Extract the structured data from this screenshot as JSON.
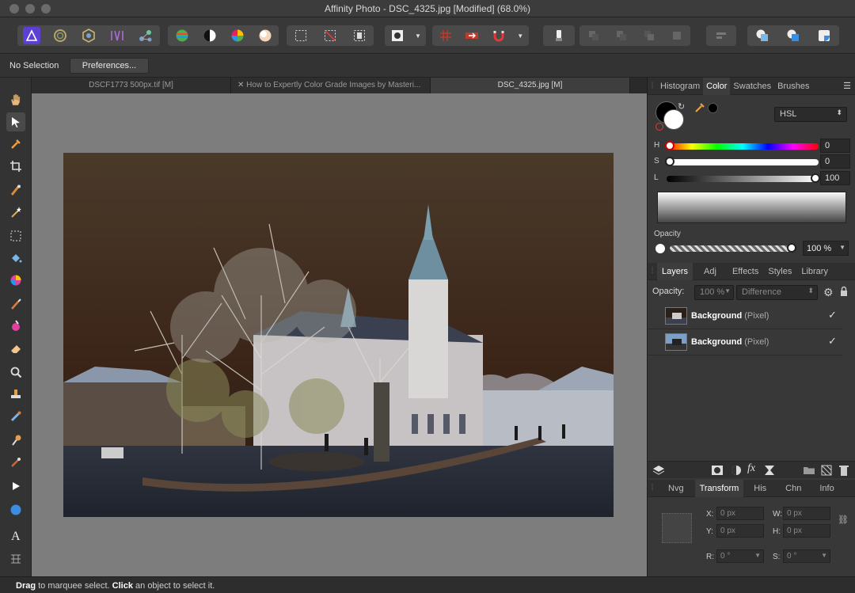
{
  "window": {
    "title": "Affinity Photo - DSC_4325.jpg [Modified] (68.0%)"
  },
  "context": {
    "selection": "No Selection",
    "preferences_label": "Preferences..."
  },
  "tabs": [
    {
      "label": "DSCF1773 500px.tif [M]"
    },
    {
      "label": "How to Expertly Color Grade Images by Masteri..."
    },
    {
      "label": "DSC_4325.jpg [M]"
    }
  ],
  "color_panel": {
    "tabs": [
      "Histogram",
      "Color",
      "Swatches",
      "Brushes"
    ],
    "model": "HSL",
    "h_label": "H",
    "h_value": "0",
    "s_label": "S",
    "s_value": "0",
    "l_label": "L",
    "l_value": "100",
    "opacity_label": "Opacity",
    "opacity_value": "100 %"
  },
  "layers_panel": {
    "tabs": [
      "Layers",
      "Adj",
      "Effects",
      "Styles",
      "Library"
    ],
    "opacity_label": "Opacity:",
    "opacity_value": "100 %",
    "blend_mode": "Difference",
    "layers": [
      {
        "name": "Background",
        "type": "(Pixel)"
      },
      {
        "name": "Background",
        "type": "(Pixel)"
      }
    ]
  },
  "transform_panel": {
    "tabs": [
      "Nvg",
      "Transform",
      "His",
      "Chn",
      "Info"
    ],
    "x_label": "X:",
    "x_value": "0 px",
    "y_label": "Y:",
    "y_value": "0 px",
    "w_label": "W:",
    "w_value": "0 px",
    "h_label": "H:",
    "h_value": "0 px",
    "r_label": "R:",
    "r_value": "0 °",
    "s_label": "S:",
    "s_value": "0 °"
  },
  "status": {
    "drag": "Drag",
    "drag_text": " to marquee select. ",
    "click": "Click",
    "click_text": " an object to select it."
  },
  "colors": {
    "accent": "#5d3fd3",
    "panel": "#383838",
    "canvas": "#7d7d7d"
  }
}
